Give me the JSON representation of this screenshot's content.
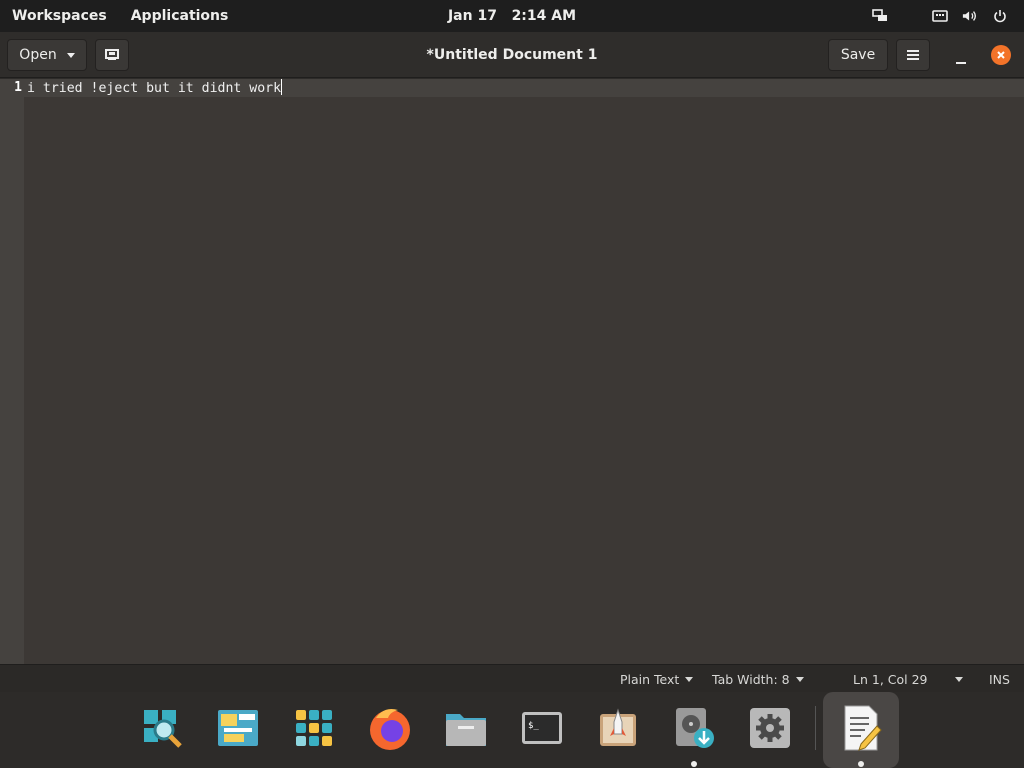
{
  "top_panel": {
    "workspaces": "Workspaces",
    "applications": "Applications",
    "date": "Jan 17",
    "time": "2:14 AM",
    "tray_icons": [
      "network-icon",
      "keyboard-icon",
      "volume-icon",
      "power-icon"
    ]
  },
  "headerbar": {
    "open_label": "Open",
    "title": "*Untitled Document 1",
    "save_label": "Save"
  },
  "editor": {
    "line_number": "1",
    "text": "i tried !eject but it didnt work"
  },
  "statusbar": {
    "language": "Plain Text",
    "tab_width": "Tab Width: 8",
    "position": "Ln 1, Col 29",
    "mode": "INS"
  },
  "dock": {
    "items": [
      "search-app-icon",
      "files-manager-icon",
      "app-grid-icon",
      "firefox-icon",
      "file-manager-icon",
      "terminal-icon",
      "app-center-icon",
      "disk-utility-icon",
      "settings-icon",
      "text-editor-icon"
    ],
    "active": "text-editor-icon"
  },
  "colors": {
    "accent_close": "#f37329",
    "editor_bg": "#3c3835",
    "panel_bg": "#1e1e1e"
  }
}
